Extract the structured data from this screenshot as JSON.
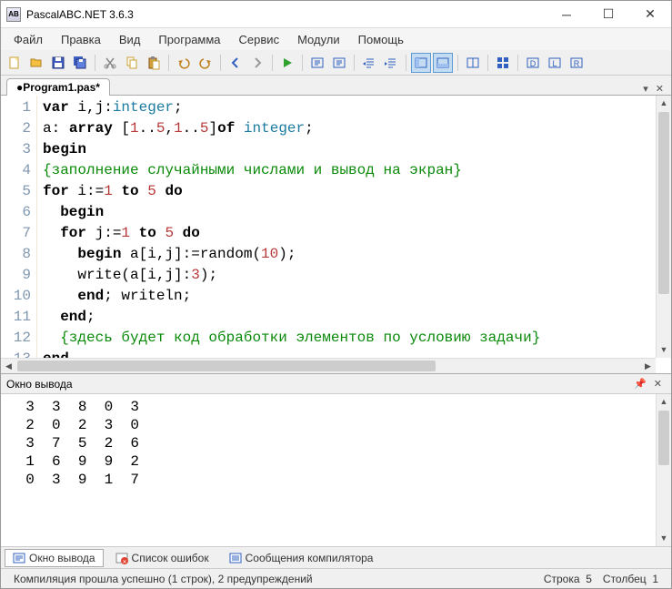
{
  "window": {
    "title": "PascalABC.NET 3.6.3",
    "appicon_text": "AB"
  },
  "menu": {
    "items": [
      "Файл",
      "Правка",
      "Вид",
      "Программа",
      "Сервис",
      "Модули",
      "Помощь"
    ]
  },
  "tab": {
    "label": "●Program1.pas*"
  },
  "code": {
    "lines": [
      [
        {
          "t": "var ",
          "c": "kw"
        },
        {
          "t": "i,j:",
          "c": ""
        },
        {
          "t": "integer",
          "c": "tp"
        },
        {
          "t": ";",
          "c": ""
        }
      ],
      [
        {
          "t": "a: ",
          "c": ""
        },
        {
          "t": "array ",
          "c": "kw"
        },
        {
          "t": "[",
          "c": ""
        },
        {
          "t": "1",
          "c": "nm"
        },
        {
          "t": "..",
          "c": ""
        },
        {
          "t": "5",
          "c": "nm"
        },
        {
          "t": ",",
          "c": ""
        },
        {
          "t": "1",
          "c": "nm"
        },
        {
          "t": "..",
          "c": ""
        },
        {
          "t": "5",
          "c": "nm"
        },
        {
          "t": "]",
          "c": ""
        },
        {
          "t": "of ",
          "c": "kw"
        },
        {
          "t": "integer",
          "c": "tp"
        },
        {
          "t": ";",
          "c": ""
        }
      ],
      [
        {
          "t": "begin",
          "c": "kw"
        }
      ],
      [
        {
          "t": "{заполнение случайными числами и вывод на экран}",
          "c": "cm"
        }
      ],
      [
        {
          "t": "for ",
          "c": "kw"
        },
        {
          "t": "i:=",
          "c": ""
        },
        {
          "t": "1",
          "c": "nm"
        },
        {
          "t": " ",
          "c": ""
        },
        {
          "t": "to ",
          "c": "kw"
        },
        {
          "t": "5",
          "c": "nm"
        },
        {
          "t": " ",
          "c": ""
        },
        {
          "t": "do",
          "c": "kw"
        }
      ],
      [
        {
          "t": "  ",
          "c": ""
        },
        {
          "t": "begin",
          "c": "kw"
        }
      ],
      [
        {
          "t": "  ",
          "c": ""
        },
        {
          "t": "for ",
          "c": "kw"
        },
        {
          "t": "j:=",
          "c": ""
        },
        {
          "t": "1",
          "c": "nm"
        },
        {
          "t": " ",
          "c": ""
        },
        {
          "t": "to ",
          "c": "kw"
        },
        {
          "t": "5",
          "c": "nm"
        },
        {
          "t": " ",
          "c": ""
        },
        {
          "t": "do",
          "c": "kw"
        }
      ],
      [
        {
          "t": "    ",
          "c": ""
        },
        {
          "t": "begin ",
          "c": "kw"
        },
        {
          "t": "a[i,j]:=random(",
          "c": ""
        },
        {
          "t": "10",
          "c": "nm"
        },
        {
          "t": ");",
          "c": ""
        }
      ],
      [
        {
          "t": "    write(a[i,j]:",
          "c": ""
        },
        {
          "t": "3",
          "c": "nm"
        },
        {
          "t": ");",
          "c": ""
        }
      ],
      [
        {
          "t": "    ",
          "c": ""
        },
        {
          "t": "end",
          "c": "kw"
        },
        {
          "t": "; writeln;",
          "c": ""
        }
      ],
      [
        {
          "t": "  ",
          "c": ""
        },
        {
          "t": "end",
          "c": "kw"
        },
        {
          "t": ";",
          "c": ""
        }
      ],
      [
        {
          "t": "  ",
          "c": ""
        },
        {
          "t": "{здесь будет код обработки элементов по условию задачи}",
          "c": "cm"
        }
      ],
      [
        {
          "t": "end",
          "c": "kw"
        },
        {
          "t": ".",
          "c": ""
        }
      ]
    ],
    "line_count": 13
  },
  "output_panel": {
    "title": "Окно вывода",
    "rows": [
      [
        3,
        3,
        8,
        0,
        3
      ],
      [
        2,
        0,
        2,
        3,
        0
      ],
      [
        3,
        7,
        5,
        2,
        6
      ],
      [
        1,
        6,
        9,
        9,
        2
      ],
      [
        0,
        3,
        9,
        1,
        7
      ]
    ]
  },
  "bottom_tabs": {
    "items": [
      {
        "label": "Окно вывода",
        "active": true
      },
      {
        "label": "Список ошибок",
        "active": false
      },
      {
        "label": "Сообщения компилятора",
        "active": false
      }
    ]
  },
  "status": {
    "compile": "Компиляция прошла успешно (1 строк), 2 предупреждений",
    "line_label": "Строка",
    "line": 5,
    "col_label": "Столбец",
    "col": 1
  }
}
